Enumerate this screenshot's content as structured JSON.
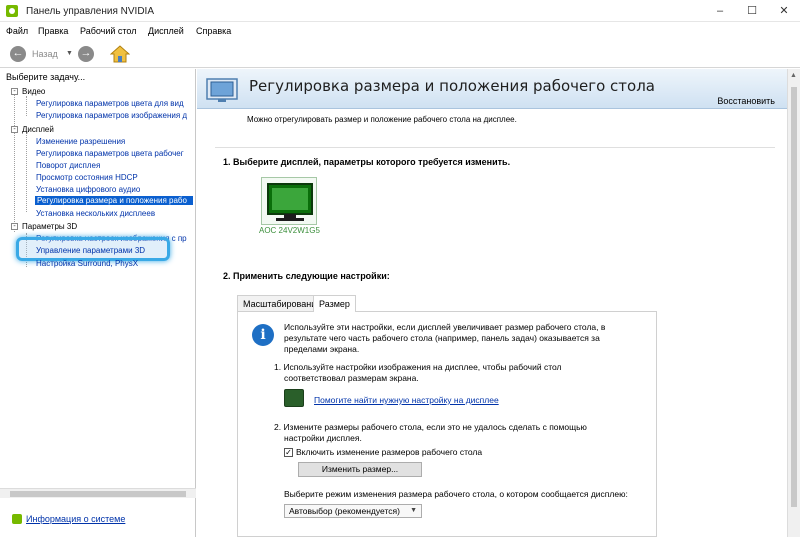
{
  "window": {
    "title": "Панель управления NVIDIA",
    "controls": [
      "–",
      "☐",
      "✕"
    ]
  },
  "menu": [
    "Файл",
    "Правка",
    "Рабочий стол",
    "Дисплей",
    "Справка"
  ],
  "toolbar": {
    "back_label": "Назад"
  },
  "sidebar": {
    "header": "Выберите задачу...",
    "categories": [
      {
        "label": "Видео",
        "items": [
          "Регулировка параметров цвета для вид",
          "Регулировка параметров изображения д"
        ]
      },
      {
        "label": "Дисплей",
        "items": [
          "Изменение разрешения",
          "Регулировка параметров цвета рабочег",
          "Поворот дисплея",
          "Просмотр состояния HDCP",
          "Установка цифрового аудио",
          "Регулировка размера и положения рабо",
          "Установка нескольких дисплеев"
        ]
      },
      {
        "label": "Параметры 3D",
        "items": [
          "Регулировка настроек изображения с пр",
          "Управление параметрами 3D",
          "Настройка Surround, PhysX"
        ]
      }
    ],
    "selected_item": "Регулировка размера и положения рабо",
    "highlighted_item": "Управление параметрами 3D",
    "system_info": "Информация о системе"
  },
  "page": {
    "title": "Регулировка размера и положения рабочего стола",
    "restore": "Восстановить",
    "description": "Можно отрегулировать размер и положение рабочего стола на дисплее.",
    "section1": "1. Выберите дисплей, параметры которого требуется изменить.",
    "display_name": "AOC 24V2W1G5",
    "section2": "2. Применить следующие настройки:",
    "tabs": [
      "Масштабирование",
      "Размер"
    ],
    "active_tab": "Размер",
    "info_text_1": "Используйте эти настройки, если дисплей увеличивает размер рабочего стола, в",
    "info_text_2": "результате чего часть рабочего стола (например, панель задач) оказывается за",
    "info_text_3": "пределами экрана.",
    "step1_line1": "1. Используйте настройки изображения на дисплее, чтобы рабочий стол",
    "step1_line2": "соответствовал размерам экрана.",
    "help_link": "Помогите найти нужную настройку на дисплее",
    "step2_line1": "2. Измените размеры рабочего стола, если это не удалось сделать с помощью",
    "step2_line2": "настройки дисплея.",
    "checkbox_label": "Включить изменение размеров рабочего стола",
    "checkbox_checked": true,
    "resize_button": "Изменить размер...",
    "mode_label": "Выберите режим изменения размера рабочего стола, о котором сообщается дисплею:",
    "mode_value": "Автовыбор (рекомендуется)"
  },
  "colors": {
    "nvidia_green": "#76b900",
    "selection": "#0a5fcf",
    "highlight": "#39a9e6",
    "link": "#0033aa"
  }
}
